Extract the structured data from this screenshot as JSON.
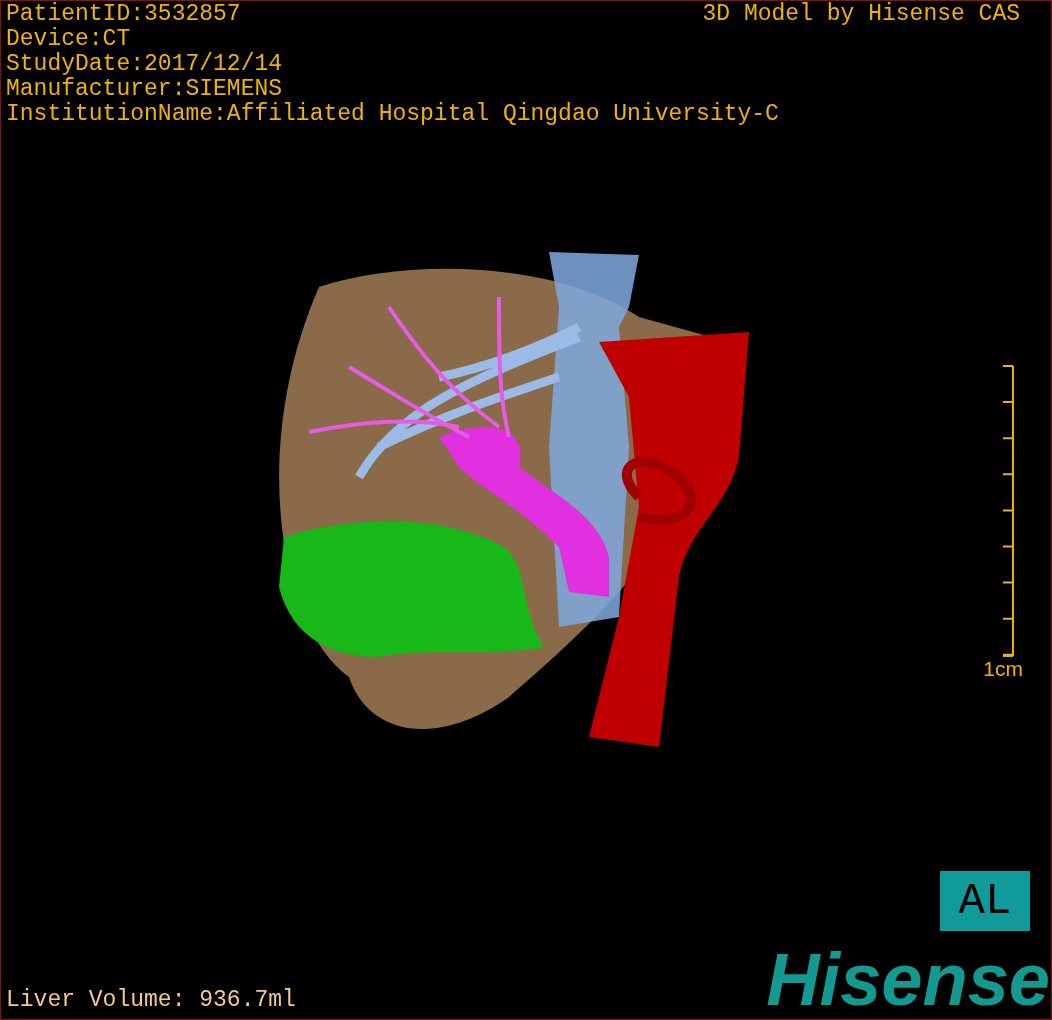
{
  "info_lines": [
    "PatientID:3532857",
    "Device:CT",
    "StudyDate:2017/12/14",
    "Manufacturer:SIEMENS",
    "InstitutionName:Affiliated Hospital Qingdao University-C"
  ],
  "credit": "3D Model by Hisense CAS",
  "scale": {
    "label": "1cm"
  },
  "orientation": "AL",
  "volume": "Liver Volume:  936.7ml",
  "logo": "Hisense"
}
